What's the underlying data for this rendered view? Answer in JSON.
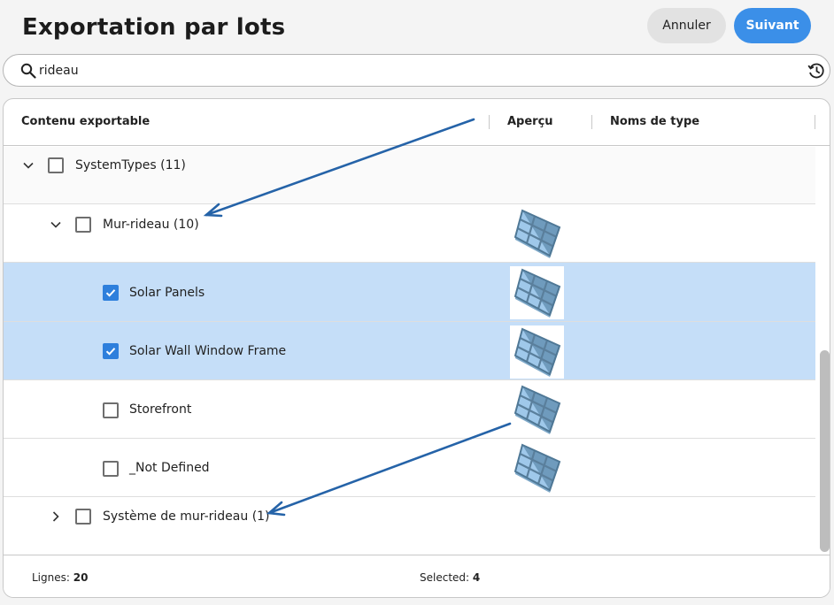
{
  "header": {
    "title": "Exportation par lots",
    "cancel_label": "Annuler",
    "next_label": "Suivant"
  },
  "search": {
    "value": "rideau",
    "icon": "search-icon",
    "history_icon": "history-icon"
  },
  "table": {
    "columns": [
      "Contenu exportable",
      "Aperçu",
      "Noms de type"
    ],
    "rows": [
      {
        "label": "SystemTypes (11)",
        "checked": false,
        "expanded": true
      },
      {
        "label": "Mur-rideau (10)",
        "checked": false,
        "expanded": true,
        "preview": "curtain-wall-icon"
      },
      {
        "label": "Solar Panels",
        "checked": true,
        "preview": "curtain-wall-icon"
      },
      {
        "label": "Solar Wall Window Frame",
        "checked": true,
        "preview": "curtain-wall-icon"
      },
      {
        "label": "Storefront",
        "checked": false,
        "preview": "curtain-wall-icon"
      },
      {
        "label": "_Not Defined",
        "checked": false,
        "preview": "curtain-wall-icon"
      },
      {
        "label": "Système de mur-rideau (1)",
        "checked": false,
        "expanded": false
      }
    ]
  },
  "footer": {
    "rows_label": "Lignes:",
    "rows_value": "20",
    "selected_label": "Selected:",
    "selected_value": "4"
  },
  "colors": {
    "accent": "#3b8fe8",
    "selected_row": "#c5def8",
    "annotation_arrow": "#2563a8"
  }
}
